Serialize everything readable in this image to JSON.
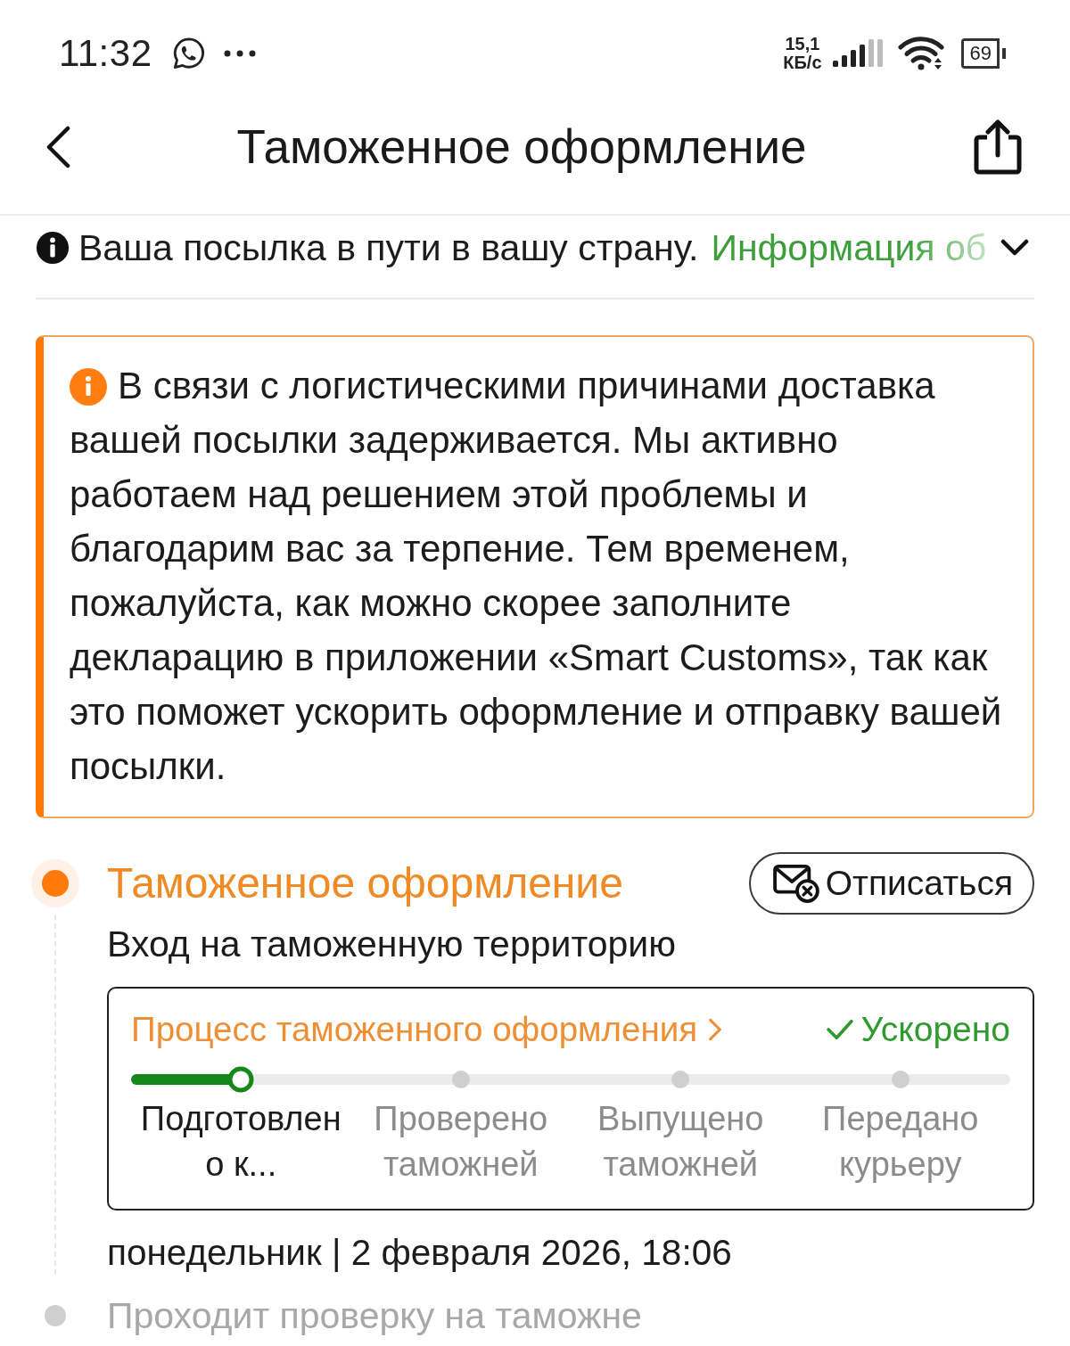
{
  "status_bar": {
    "time": "11:32",
    "speed_value": "15,1",
    "speed_unit": "КБ/с",
    "battery": "69"
  },
  "header": {
    "title": "Таможенное оформление"
  },
  "notice": {
    "text": "Ваша посылка в пути в вашу страну.",
    "link": "Информация об",
    "expanded": false
  },
  "alert": {
    "text": "В связи с логистическими причинами доставка вашей посылки задерживается. Мы активно работаем над решением этой проблемы и благодарим вас за терпение. Тем временем, пожалуйста, как можно скорее заполните декларацию в приложении «Smart Customs», так как это поможет ускорить оформление и отправку вашей посылки."
  },
  "timeline": [
    {
      "kind": "current",
      "title": "Таможенное оформление",
      "subtitle": "Вход на таможенную территорию",
      "button": "Отписаться",
      "process": {
        "title": "Процесс таможенного оформления",
        "status": "Ускорено",
        "level": 0.125,
        "steps": [
          {
            "label": "Подготовлено к...",
            "selected": true
          },
          {
            "label": "Проверено таможней",
            "selected": false
          },
          {
            "label": "Выпущено таможней",
            "selected": false
          },
          {
            "label": "Передано курьеру",
            "selected": false
          }
        ]
      },
      "date": "понедельник | 2 февраля 2026, 18:06"
    },
    {
      "kind": "pending",
      "title": "Проходит проверку на таможне"
    }
  ]
}
